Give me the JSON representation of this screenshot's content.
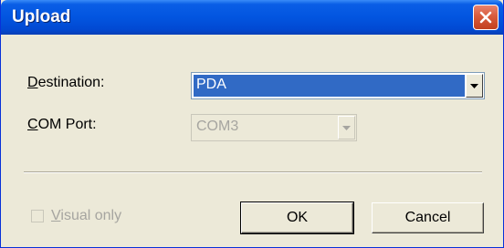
{
  "window": {
    "title": "Upload"
  },
  "destination": {
    "label_mnemonic": "D",
    "label_rest": "estination:",
    "value": "PDA"
  },
  "com_port": {
    "label_mnemonic": "C",
    "label_rest": "OM Port:",
    "value": "COM3"
  },
  "visual_only": {
    "label_mnemonic": "V",
    "label_rest": "isual only",
    "checked": false
  },
  "buttons": {
    "ok": "OK",
    "cancel": "Cancel"
  },
  "colors": {
    "titlebar": "#0255e0",
    "selection": "#316ac5",
    "close_button": "#d85b3c",
    "dialog_background": "#ece9d8"
  },
  "icons": {
    "close": "close-icon",
    "dropdown": "chevron-down-icon"
  }
}
